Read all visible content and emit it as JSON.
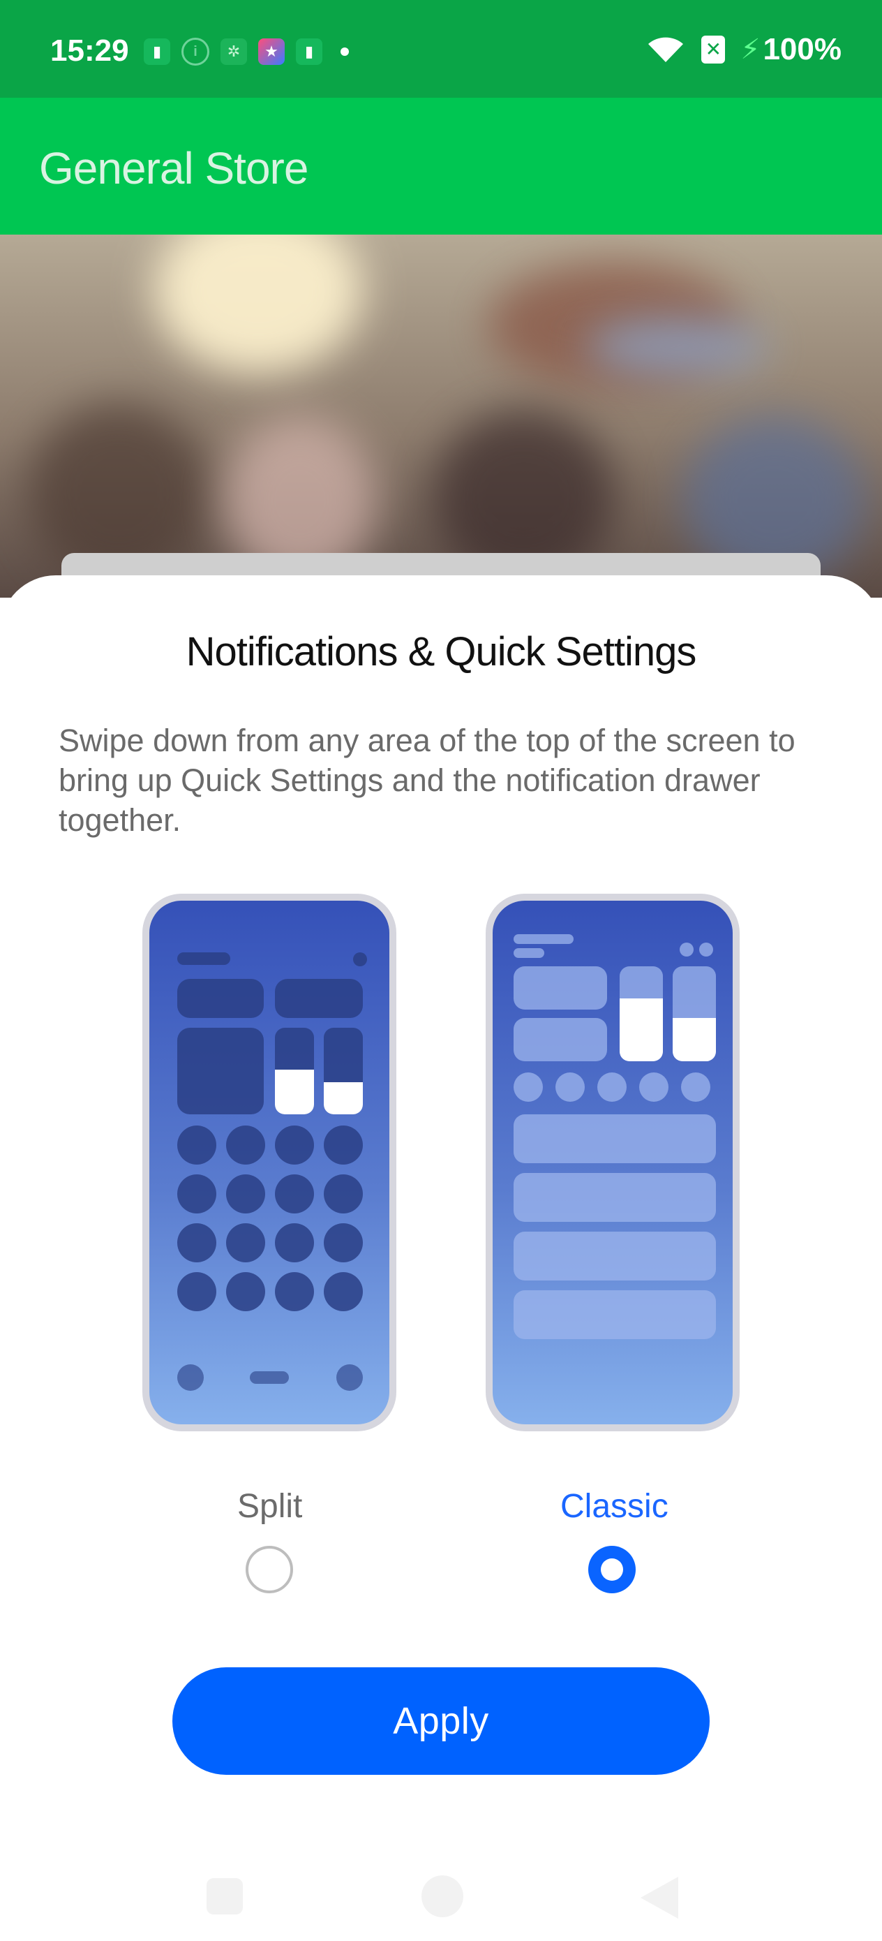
{
  "status_bar": {
    "time": "15:29",
    "battery_percent": "100%",
    "icons": [
      "battery-saver-icon",
      "info-icon",
      "robot-icon",
      "app-icon",
      "battery-saver-icon",
      "dot-icon",
      "wifi-icon",
      "sim-icon",
      "charging-icon"
    ]
  },
  "app_bar": {
    "title": "General Store"
  },
  "sheet": {
    "title": "Notifications & Quick Settings",
    "description": "Swipe down from any area of the top of the screen to bring up Quick Settings and the notification drawer together.",
    "options": [
      {
        "label": "Split",
        "selected": false
      },
      {
        "label": "Classic",
        "selected": true
      }
    ],
    "apply_label": "Apply"
  },
  "colors": {
    "status_bar": "#0aa547",
    "app_bar": "#00c652",
    "accent": "#0062ff"
  }
}
